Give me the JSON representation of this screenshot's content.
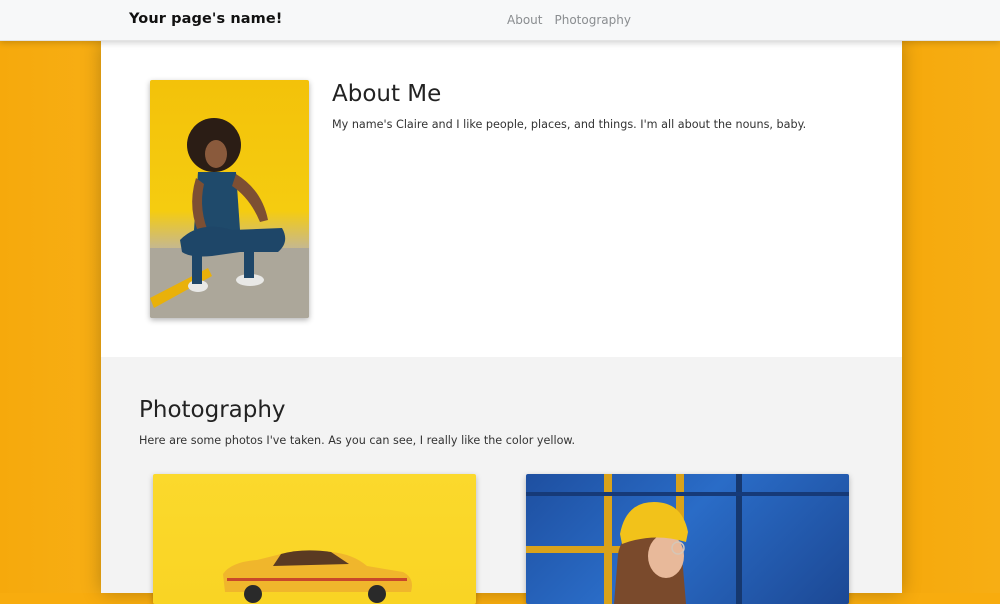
{
  "navbar": {
    "brand": "Your page's name!",
    "links": [
      "About",
      "Photography"
    ]
  },
  "about": {
    "title": "About Me",
    "text": "My name's Claire and I like people, places, and things. I'm all about the nouns, baby."
  },
  "photography": {
    "title": "Photography",
    "text": "Here are some photos I've taken. As you can see, I really like the color yellow."
  },
  "colors": {
    "page_background": "#f8ac0e",
    "navbar_background": "#f7f8f9",
    "about_background": "#ffffff",
    "photography_background": "#f3f3f3"
  }
}
